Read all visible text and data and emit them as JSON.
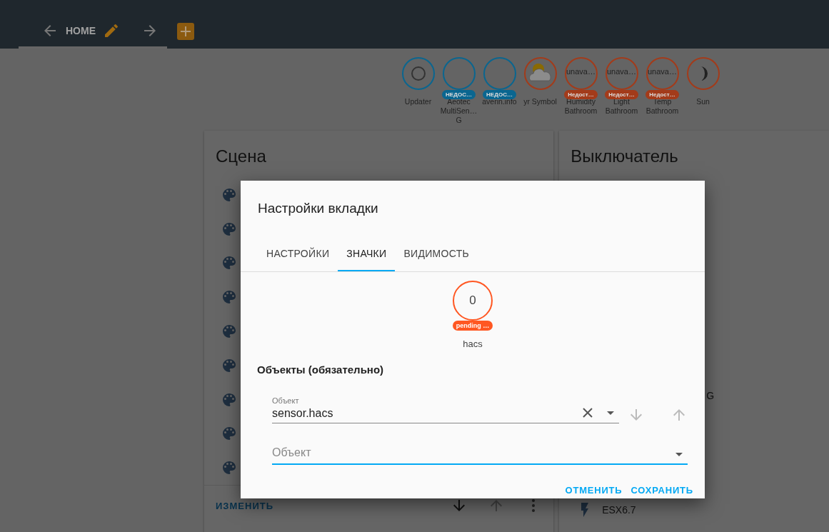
{
  "header": {
    "view_title": "HOME"
  },
  "badges": [
    {
      "name": "Updater",
      "kind": "icon",
      "color": "#0a6690"
    },
    {
      "name": "Aeotec MultiSen… G",
      "kind": "blank",
      "color": "#0a6690",
      "label": "НЕДОС…"
    },
    {
      "name": "averin.info",
      "kind": "blank",
      "color": "#0a6690",
      "label": "НЕДОС…"
    },
    {
      "name": "yr Symbol",
      "kind": "picture",
      "color": "#a33b1a"
    },
    {
      "name": "Humidity Bathroom",
      "kind": "value",
      "color": "#a33b1a",
      "value": "unava…",
      "label": "Недост…"
    },
    {
      "name": "Light Bathroom",
      "kind": "value",
      "color": "#a33b1a",
      "value": "unava…",
      "label": "Недост…"
    },
    {
      "name": "Temp Bathroom",
      "kind": "value",
      "color": "#a33b1a",
      "value": "unava…",
      "label": "Недост…"
    },
    {
      "name": "Sun",
      "kind": "moon",
      "color": "#a33b1a"
    }
  ],
  "scene_card": {
    "title": "Сцена",
    "edit_button": "ИЗМЕНИТЬ"
  },
  "switch_card": {
    "title": "Выключатель",
    "rows": [
      {
        "text": "G",
        "kind": "tail"
      },
      {
        "text": "ESX6.7",
        "kind": "full"
      }
    ]
  },
  "dialog": {
    "title": "Настройки вкладки",
    "tabs": [
      {
        "label": "НАСТРОЙКИ",
        "selected": false
      },
      {
        "label": "ЗНАЧКИ",
        "selected": true
      },
      {
        "label": "ВИДИМОСТЬ",
        "selected": false
      }
    ],
    "preview": {
      "value": "0",
      "label": "pending …",
      "name": "hacs",
      "color": "#ff5722"
    },
    "section_title": "Объекты (обязательно)",
    "entity_field": {
      "label": "Объект",
      "value": "sensor.hacs"
    },
    "new_field": {
      "placeholder": "Объект"
    },
    "buttons": [
      "ОТМЕНИТЬ",
      "СОХРАНИТЬ"
    ]
  }
}
